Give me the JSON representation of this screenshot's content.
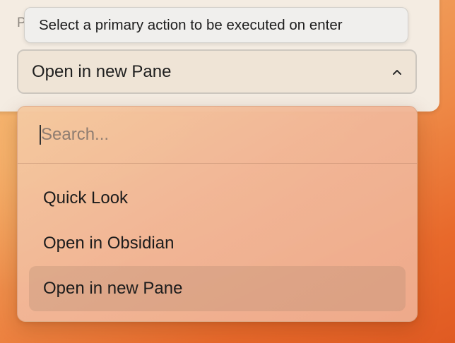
{
  "field": {
    "label": "P",
    "tooltip": "Select a primary action to be executed on enter",
    "selected_value": "Open in new Pane",
    "chevron_icon": "chevron-up-icon"
  },
  "dropdown": {
    "search_placeholder": "Search...",
    "search_value": "",
    "options": [
      {
        "label": "Quick Look",
        "selected": false
      },
      {
        "label": "Open in Obsidian",
        "selected": false
      },
      {
        "label": "Open in new Pane",
        "selected": true
      }
    ]
  },
  "colors": {
    "highlight": "#d9a28a",
    "panel": "#f4ece2",
    "dropdown": "#f1b798"
  }
}
